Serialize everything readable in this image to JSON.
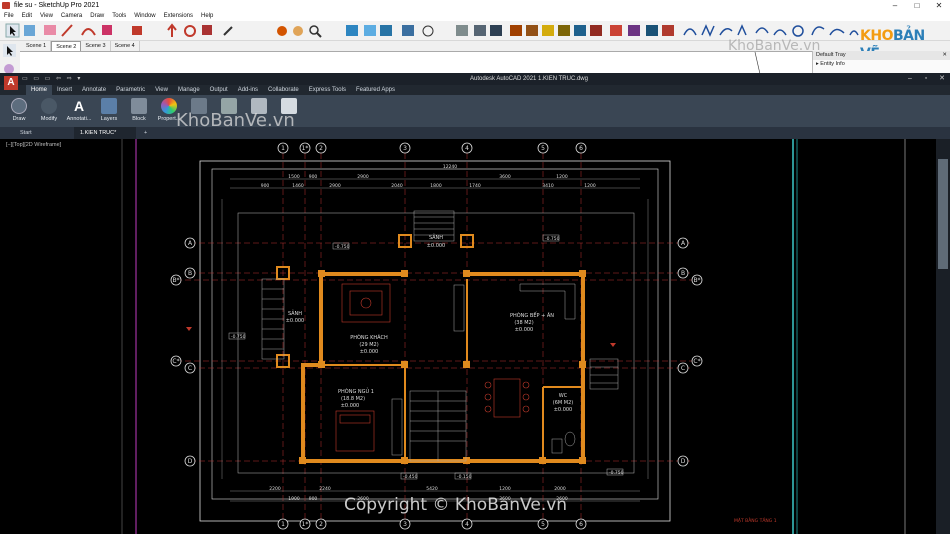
{
  "sketchup": {
    "title": "file su - SketchUp Pro 2021",
    "menu": [
      "File",
      "Edit",
      "View",
      "Camera",
      "Draw",
      "Tools",
      "Window",
      "Extensions",
      "Help"
    ],
    "scenes": [
      "Scene 1",
      "Scene 2",
      "Scene 3",
      "Scene 4"
    ],
    "active_scene": "Scene 2",
    "tray": {
      "title": "Default Tray",
      "entity_info": "Entity Info"
    }
  },
  "logo": {
    "part1": "KHO",
    "part2": "BẢN VẼ"
  },
  "watermarks": {
    "top": "KhoBanVe.vn",
    "mid": "KhoBanVe.vn",
    "copyright": "Copyright © KhoBanVe.vn"
  },
  "autocad": {
    "title": "Autodesk AutoCAD 2021   1.KIEN TRUC.dwg",
    "ribbon_tabs": [
      "Home",
      "Insert",
      "Annotate",
      "Parametric",
      "View",
      "Manage",
      "Output",
      "Add-ins",
      "Collaborate",
      "Express Tools",
      "Featured Apps"
    ],
    "active_tab": "Home",
    "ribbon_buttons": [
      "Draw",
      "Modify",
      "Annotati...",
      "Layers",
      "Block",
      "Propert...",
      "",
      "",
      "",
      ""
    ],
    "file_tabs": {
      "start": "Start",
      "file": "1.KIEN TRUC*",
      "plus": "+"
    },
    "view_label": "[−][Top][2D Wireframe]"
  },
  "drawing": {
    "rooms": [
      {
        "name": "SẢNH",
        "level": "±0.000"
      },
      {
        "name": "SẢNH",
        "level": "±0.000"
      },
      {
        "name": "PHÒNG KHÁCH",
        "area": "(29 M2)",
        "level": "±0.000"
      },
      {
        "name": "PHÒNG BẾP + ĂN",
        "area": "(38 M2)",
        "level": "±0.000"
      },
      {
        "name": "PHÒNG NGỦ 1",
        "area": "(18.8 M2)",
        "level": "±0.000"
      },
      {
        "name": "WC",
        "area": "(6M M2)",
        "level": "±0.000"
      }
    ],
    "grid_cols": [
      "1",
      "1*",
      "2",
      "3",
      "4",
      "5",
      "6"
    ],
    "grid_rows": [
      "A",
      "B",
      "B*",
      "C",
      "C*",
      "D"
    ],
    "dims_top_total": "12240",
    "dims_top": [
      "1500",
      "900",
      "2900",
      "3600",
      "1200"
    ],
    "dims_top2": [
      "900",
      "1460",
      "2900",
      "2040",
      "1800",
      "1740",
      "3410",
      "1200"
    ],
    "dims_bottom": [
      "2200",
      "2240",
      "5420",
      "1200",
      "2000"
    ],
    "dims_bottom2": [
      "1900",
      "900",
      "2600",
      "3600",
      "2600"
    ],
    "levels": [
      "-0.750",
      "-0.750",
      "-0.750",
      "-0.450",
      "-0.150",
      "-0.750"
    ],
    "note": "MẶT BẰNG TẦNG 1"
  }
}
